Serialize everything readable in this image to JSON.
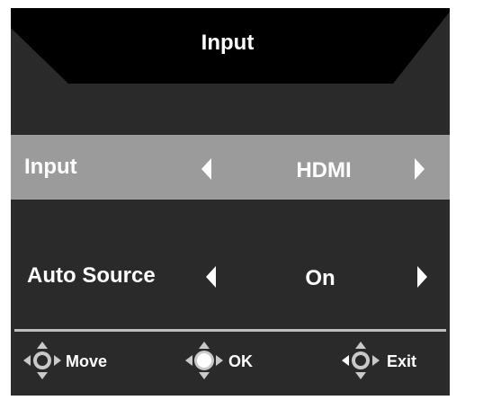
{
  "osd": {
    "title": "Input",
    "rows": [
      {
        "label": "Input",
        "value": "HDMI",
        "selected": true
      },
      {
        "label": "Auto Source",
        "value": "On",
        "selected": false
      }
    ],
    "footer": [
      {
        "label": "Move",
        "icon": "joystick-move-icon"
      },
      {
        "label": "OK",
        "icon": "joystick-ok-icon"
      },
      {
        "label": "Exit",
        "icon": "joystick-exit-icon"
      }
    ]
  },
  "colors": {
    "panel": "#2a2a2a",
    "title_bar": "#000000",
    "selected_row": "#9b9b9b",
    "text": "#ffffff",
    "divider": "#bdbdbd",
    "icon": "#c9c9c9"
  }
}
